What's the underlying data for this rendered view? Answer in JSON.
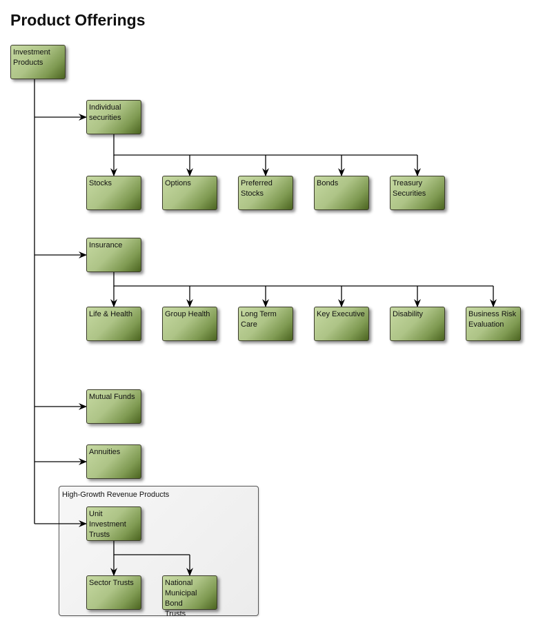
{
  "title": "Product Offerings",
  "group": {
    "label": "High-Growth Revenue Products"
  },
  "nodes": {
    "investment_products": "Investment\nProducts",
    "individual_securities": "Individual\nsecurities",
    "stocks": "Stocks",
    "options": "Options",
    "preferred_stocks": "Preferred\nStocks",
    "bonds": "Bonds",
    "treasury_securities": "Treasury\nSecurities",
    "insurance": "Insurance",
    "life_health": "Life & Health",
    "group_health": "Group Health",
    "long_term_care": "Long Term\nCare",
    "key_executive": "Key Executive",
    "disability": "Disability",
    "business_risk": "Business Risk\nEvaluation",
    "mutual_funds": "Mutual Funds",
    "annuities": "Annuities",
    "unit_investment_trusts": "Unit\nInvestment\nTrusts",
    "sector_trusts": "Sector Trusts",
    "national_municipal_bond_trusts": "National\nMunicipal Bond\nTrusts"
  },
  "edges": [
    [
      "investment_products",
      "individual_securities"
    ],
    [
      "investment_products",
      "insurance"
    ],
    [
      "investment_products",
      "mutual_funds"
    ],
    [
      "investment_products",
      "annuities"
    ],
    [
      "investment_products",
      "unit_investment_trusts"
    ],
    [
      "individual_securities",
      "stocks"
    ],
    [
      "individual_securities",
      "options"
    ],
    [
      "individual_securities",
      "preferred_stocks"
    ],
    [
      "individual_securities",
      "bonds"
    ],
    [
      "individual_securities",
      "treasury_securities"
    ],
    [
      "insurance",
      "life_health"
    ],
    [
      "insurance",
      "group_health"
    ],
    [
      "insurance",
      "long_term_care"
    ],
    [
      "insurance",
      "key_executive"
    ],
    [
      "insurance",
      "disability"
    ],
    [
      "insurance",
      "business_risk"
    ],
    [
      "unit_investment_trusts",
      "sector_trusts"
    ],
    [
      "unit_investment_trusts",
      "national_municipal_bond_trusts"
    ]
  ]
}
